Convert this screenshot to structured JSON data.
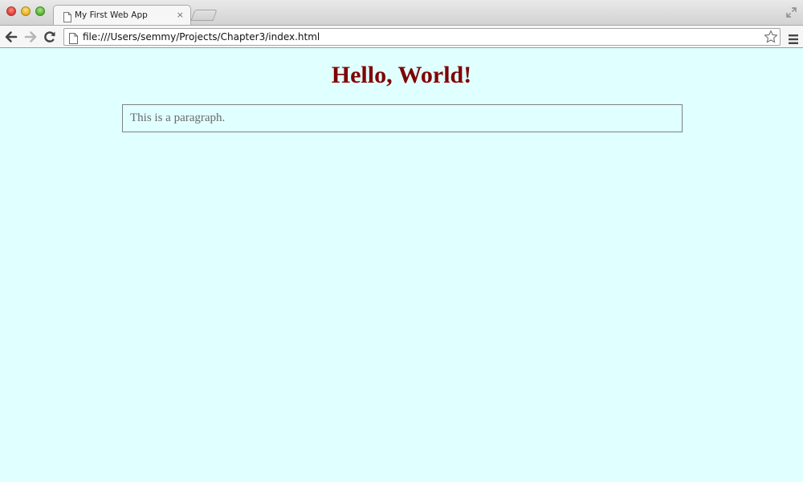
{
  "browser": {
    "tab_title": "My First Web App",
    "tab_close_glyph": "×",
    "url": "file:///Users/semmy/Projects/Chapter3/index.html",
    "icons": {
      "back": "back-arrow-icon",
      "forward": "forward-arrow-icon",
      "reload": "reload-icon",
      "page": "document-icon",
      "bookmark": "star-icon",
      "menu": "menu-icon",
      "fullscreen": "fullscreen-icon"
    }
  },
  "page": {
    "heading": "Hello, World!",
    "paragraph": "This is a paragraph.",
    "colors": {
      "background": "#e0ffff",
      "heading": "#800000",
      "paragraph_text": "#6a6a6a",
      "paragraph_border": "#808080"
    }
  }
}
